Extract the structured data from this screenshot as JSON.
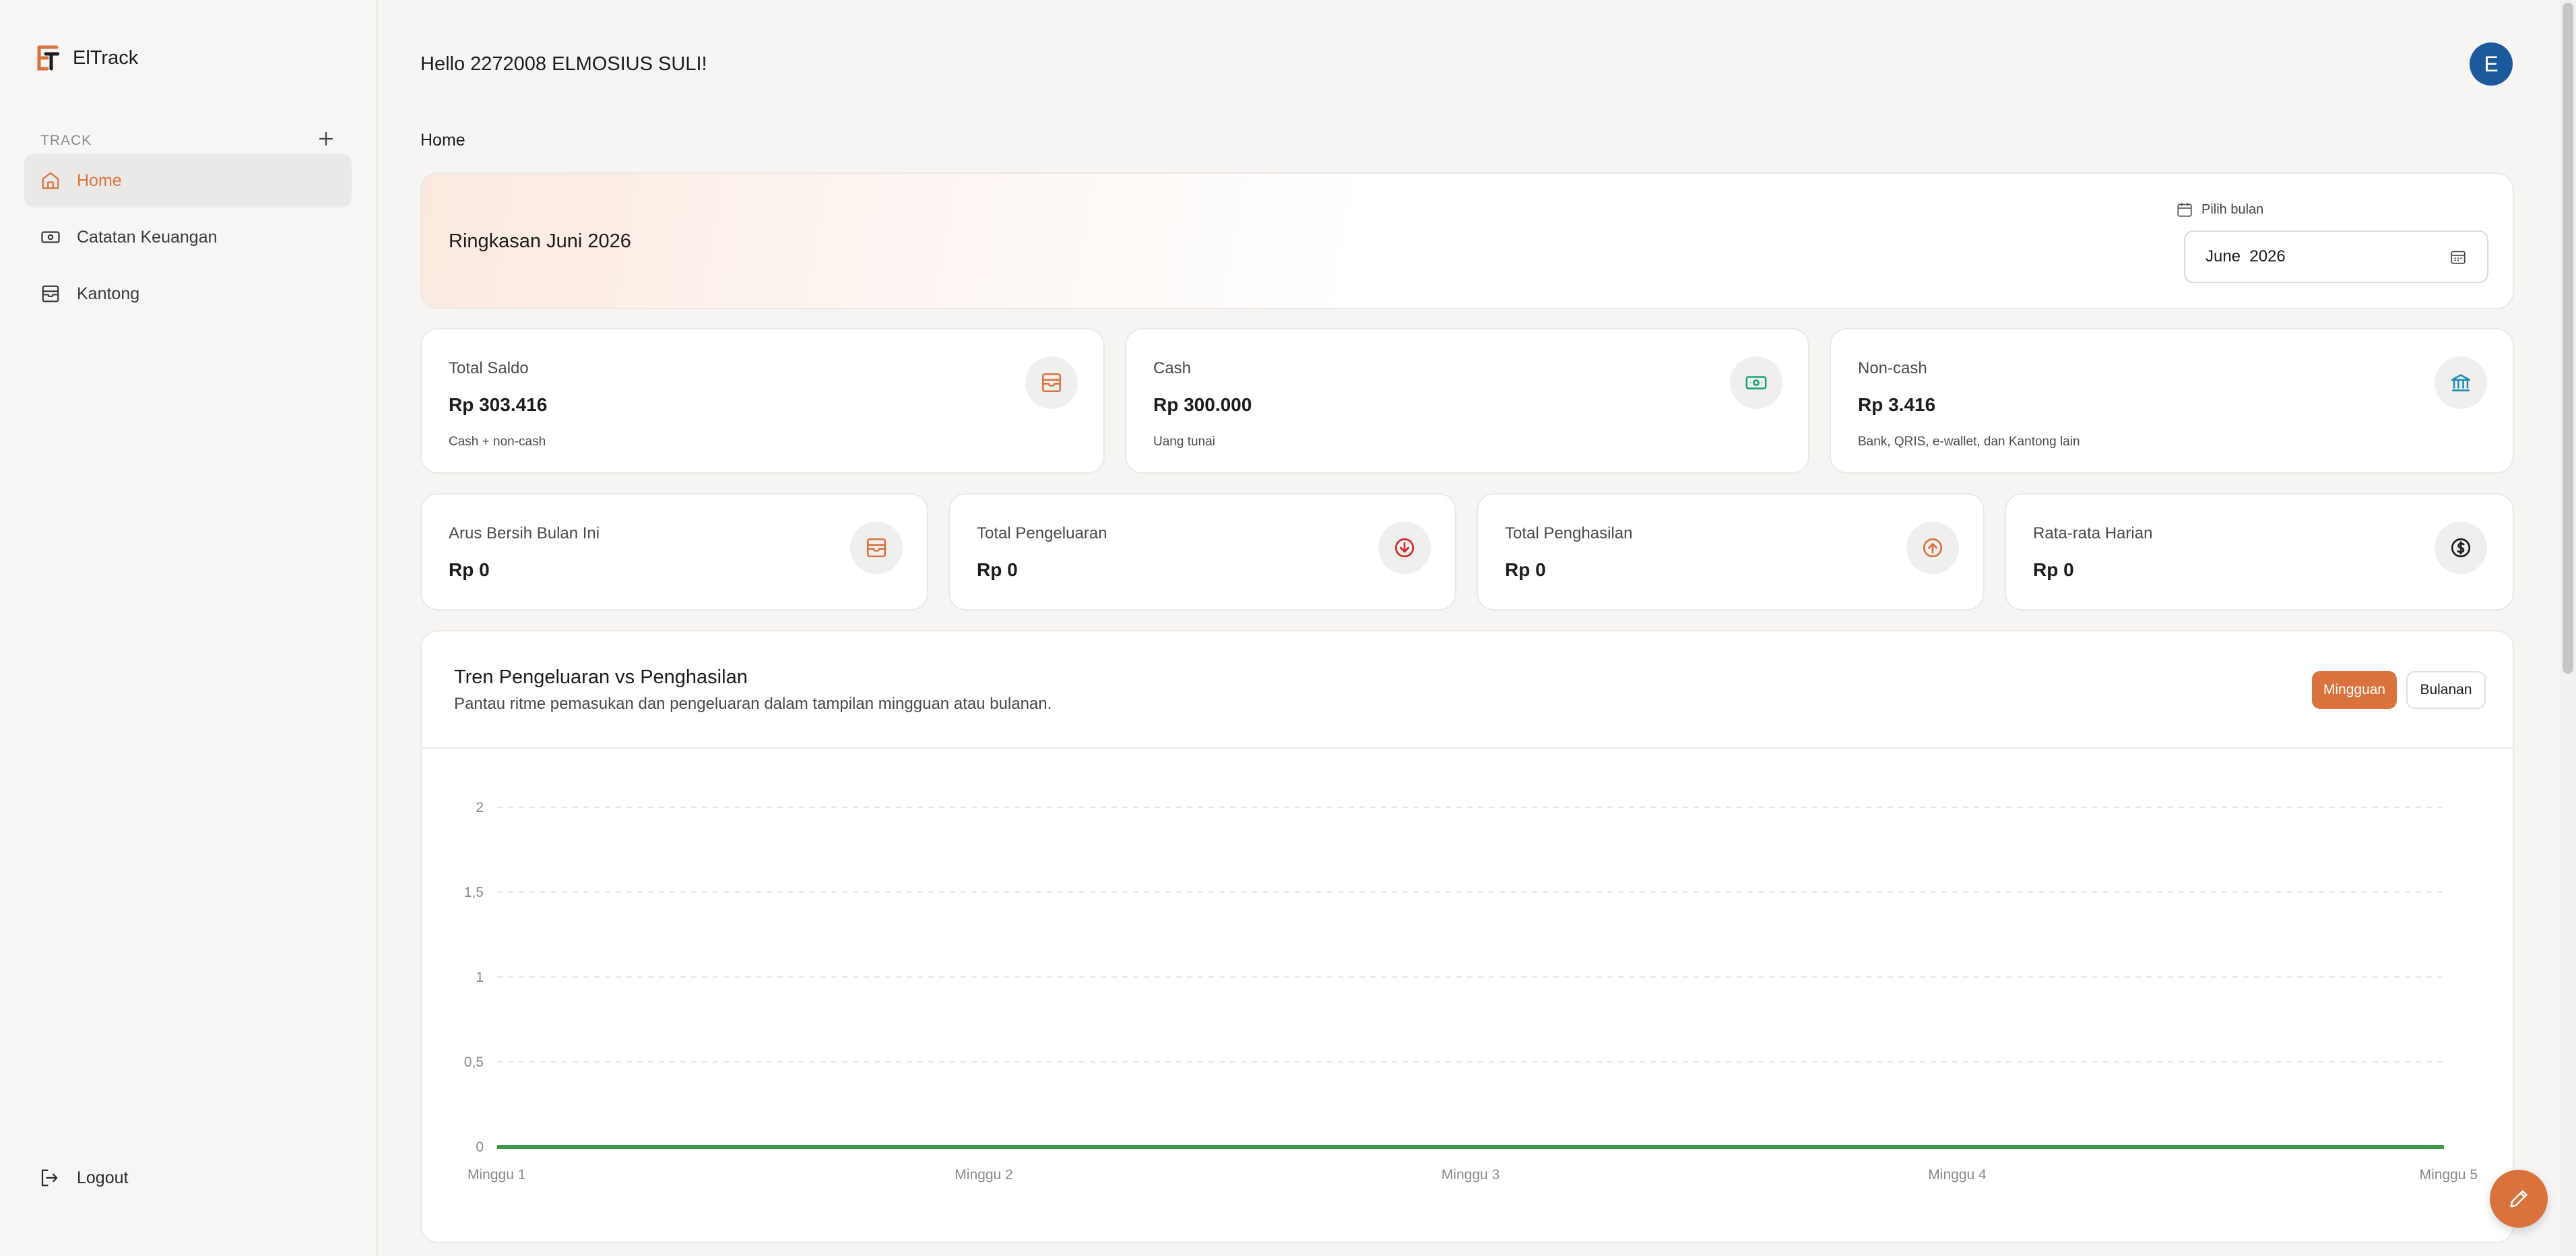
{
  "app": {
    "name": "ElTrack"
  },
  "header": {
    "greeting": "Hello 2272008 ELMOSIUS SULI!",
    "avatar_initial": "E"
  },
  "sidebar": {
    "section_label": "TRACK",
    "items": [
      {
        "label": "Home",
        "icon": "home-icon",
        "active": true
      },
      {
        "label": "Catatan Keuangan",
        "icon": "money-icon",
        "active": false
      },
      {
        "label": "Kantong",
        "icon": "wallet-icon",
        "active": false
      }
    ],
    "logout_label": "Logout"
  },
  "breadcrumb": "Home",
  "summary": {
    "title": "Ringkasan Juni 2026",
    "month_picker_label": "Pilih bulan",
    "month_value": "June  2026"
  },
  "stats_row1": [
    {
      "label": "Total Saldo",
      "value": "Rp 303.416",
      "sub": "Cash + non-cash",
      "icon": "wallet-icon",
      "icon_color": "#d9723c"
    },
    {
      "label": "Cash",
      "value": "Rp 300.000",
      "sub": "Uang tunai",
      "icon": "banknote-icon",
      "icon_color": "#12a37a"
    },
    {
      "label": "Non-cash",
      "value": "Rp 3.416",
      "sub": "Bank, QRIS, e-wallet, dan Kantong lain",
      "icon": "bank-icon",
      "icon_color": "#1b8ab8"
    }
  ],
  "stats_row2": [
    {
      "label": "Arus Bersih Bulan Ini",
      "value": "Rp 0",
      "icon": "wallet-icon",
      "icon_color": "#d9723c"
    },
    {
      "label": "Total Pengeluaran",
      "value": "Rp 0",
      "icon": "arrow-down-circle-icon",
      "icon_color": "#d42a2a"
    },
    {
      "label": "Total Penghasilan",
      "value": "Rp 0",
      "icon": "arrow-up-circle-icon",
      "icon_color": "#d9723c"
    },
    {
      "label": "Rata-rata Harian",
      "value": "Rp 0",
      "icon": "dollar-circle-icon",
      "icon_color": "#1c1c1c"
    }
  ],
  "chart_section": {
    "title": "Tren Pengeluaran vs Penghasilan",
    "subtitle": "Pantau ritme pemasukan dan pengeluaran dalam tampilan mingguan atau bulanan.",
    "tabs": [
      {
        "label": "Mingguan",
        "active": true
      },
      {
        "label": "Bulanan",
        "active": false
      }
    ]
  },
  "chart_data": {
    "type": "line",
    "categories": [
      "Minggu 1",
      "Minggu 2",
      "Minggu 3",
      "Minggu 4",
      "Minggu 5"
    ],
    "series": [
      {
        "values": [
          0,
          0,
          0,
          0,
          0
        ],
        "color": "#3f9a4f"
      }
    ],
    "ylim": [
      0,
      2
    ],
    "yticks": [
      "0",
      "0,5",
      "1",
      "1,5",
      "2"
    ],
    "grid": true
  },
  "colors": {
    "accent": "#d9723c",
    "avatar": "#1c5a9c"
  }
}
